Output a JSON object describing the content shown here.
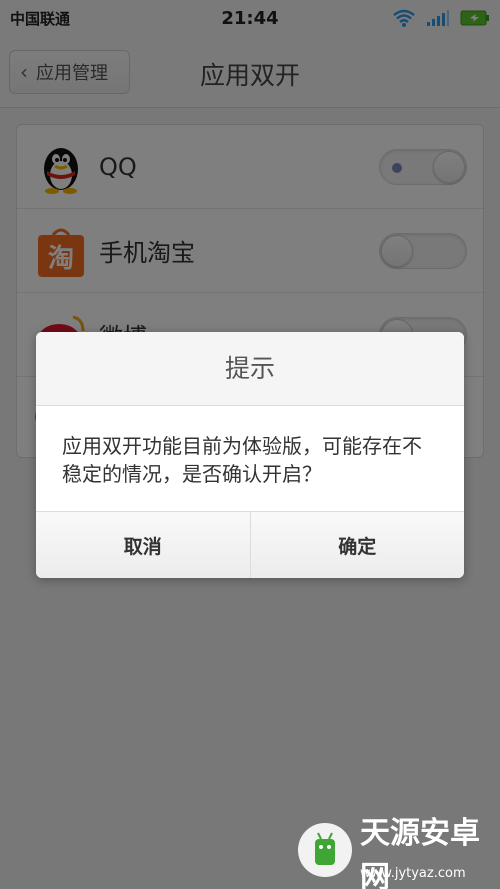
{
  "status_bar": {
    "carrier": "中国联通",
    "time": "21:44"
  },
  "header": {
    "back_label": "应用管理",
    "title": "应用双开"
  },
  "apps": [
    {
      "name": "QQ",
      "icon": "qq-penguin-icon",
      "toggle_on": true
    },
    {
      "name": "手机淘宝",
      "icon": "taobao-icon",
      "toggle_on": false
    },
    {
      "name": "微博",
      "icon": "weibo-icon",
      "toggle_on": false
    }
  ],
  "dialog": {
    "title": "提示",
    "message": "应用双开功能目前为体验版，可能存在不稳定的情况，是否确认开启？",
    "cancel_label": "取消",
    "confirm_label": "确定"
  },
  "watermark": {
    "brand": "天源安卓网",
    "url": "www.jytyaz.com"
  },
  "colors": {
    "overlay": "#000000",
    "taobao_orange": "#f26d21",
    "weibo_red": "#e6162d",
    "wifi_blue": "#2e9be6",
    "battery_green": "#5cc72f"
  }
}
